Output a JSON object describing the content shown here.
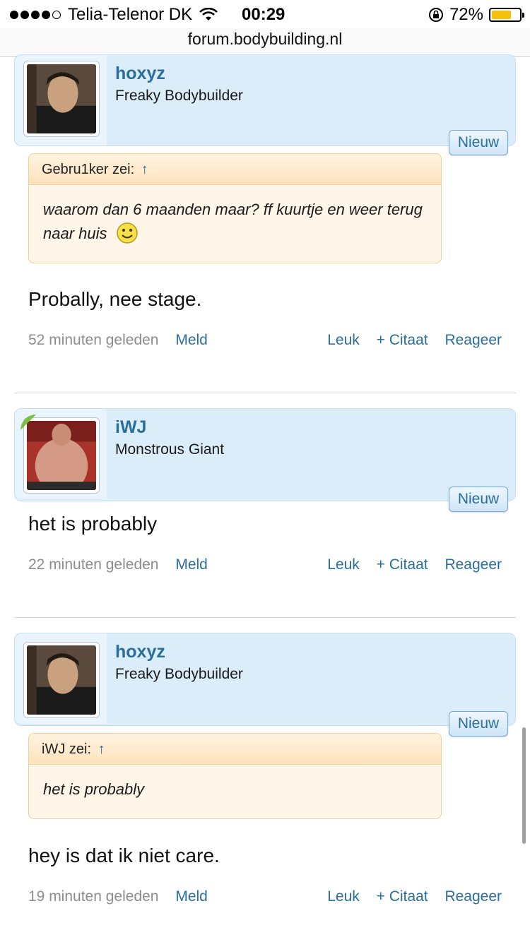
{
  "status_bar": {
    "carrier": "Telia-Telenor DK",
    "time": "00:29",
    "battery_percent": "72%",
    "signal_bars_filled": 4,
    "signal_bars_total": 5
  },
  "url": "forum.bodybuilding.nl",
  "posts": [
    {
      "username": "hoxyz",
      "rank": "Freaky Bodybuilder",
      "badge": "Nieuw",
      "quote": {
        "author": "Gebru1ker zei:",
        "arrow": "↑",
        "text": "waarom dan 6 maanden maar? ff kuurtje en weer terug naar huis"
      },
      "message": "Probally, nee stage.",
      "time_ago": "52 minuten geleden",
      "meld": "Meld",
      "leuk": "Leuk",
      "citaat": "+ Citaat",
      "reageer": "Reageer"
    },
    {
      "username": "iWJ",
      "rank": "Monstrous Giant",
      "badge": "Nieuw",
      "message": "het is probably",
      "time_ago": "22 minuten geleden",
      "meld": "Meld",
      "leuk": "Leuk",
      "citaat": "+ Citaat",
      "reageer": "Reageer"
    },
    {
      "username": "hoxyz",
      "rank": "Freaky Bodybuilder",
      "badge": "Nieuw",
      "quote": {
        "author": "iWJ zei:",
        "arrow": "↑",
        "text": "het is probably"
      },
      "message": "hey is dat ik niet care.",
      "time_ago": "19 minuten geleden",
      "meld": "Meld",
      "leuk": "Leuk",
      "citaat": "+ Citaat",
      "reageer": "Reageer"
    }
  ],
  "colors": {
    "link": "#2a6e9c",
    "header_bg": "#dcedfa",
    "quote_bg": "#fff5e8",
    "quote_border": "#f2cf94",
    "online_indicator": "#7bc043"
  }
}
